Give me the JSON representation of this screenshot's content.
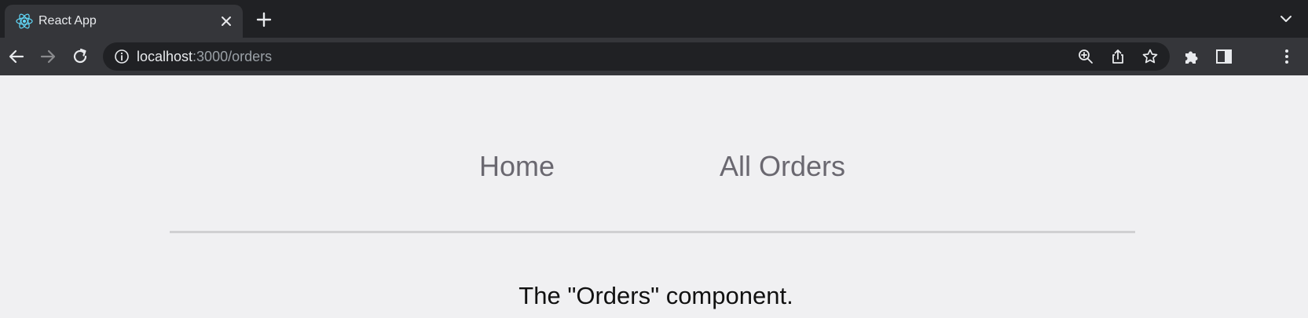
{
  "browser": {
    "tab": {
      "title": "React App",
      "favicon": "react-logo-icon"
    },
    "address_bar": {
      "host": "localhost",
      "path": ":3000/orders"
    },
    "icons": {
      "back": "arrow-left-icon",
      "forward": "arrow-right-icon",
      "reload": "reload-icon",
      "info": "info-icon",
      "zoom": "zoom-in-icon",
      "share": "share-icon",
      "bookmark": "star-icon",
      "extensions": "puzzle-icon",
      "side_panel": "side-panel-icon",
      "menu": "kebab-menu-icon"
    }
  },
  "page": {
    "nav": [
      {
        "label": "Home"
      },
      {
        "label": "All Orders"
      }
    ],
    "component_text": "The \"Orders\" component."
  },
  "colors": {
    "page_bg": "#f0f0f2",
    "nav_link": "#6a6870",
    "divider": "#d0d0d2",
    "chrome_dark": "#202124",
    "chrome_toolbar": "#35363a"
  }
}
